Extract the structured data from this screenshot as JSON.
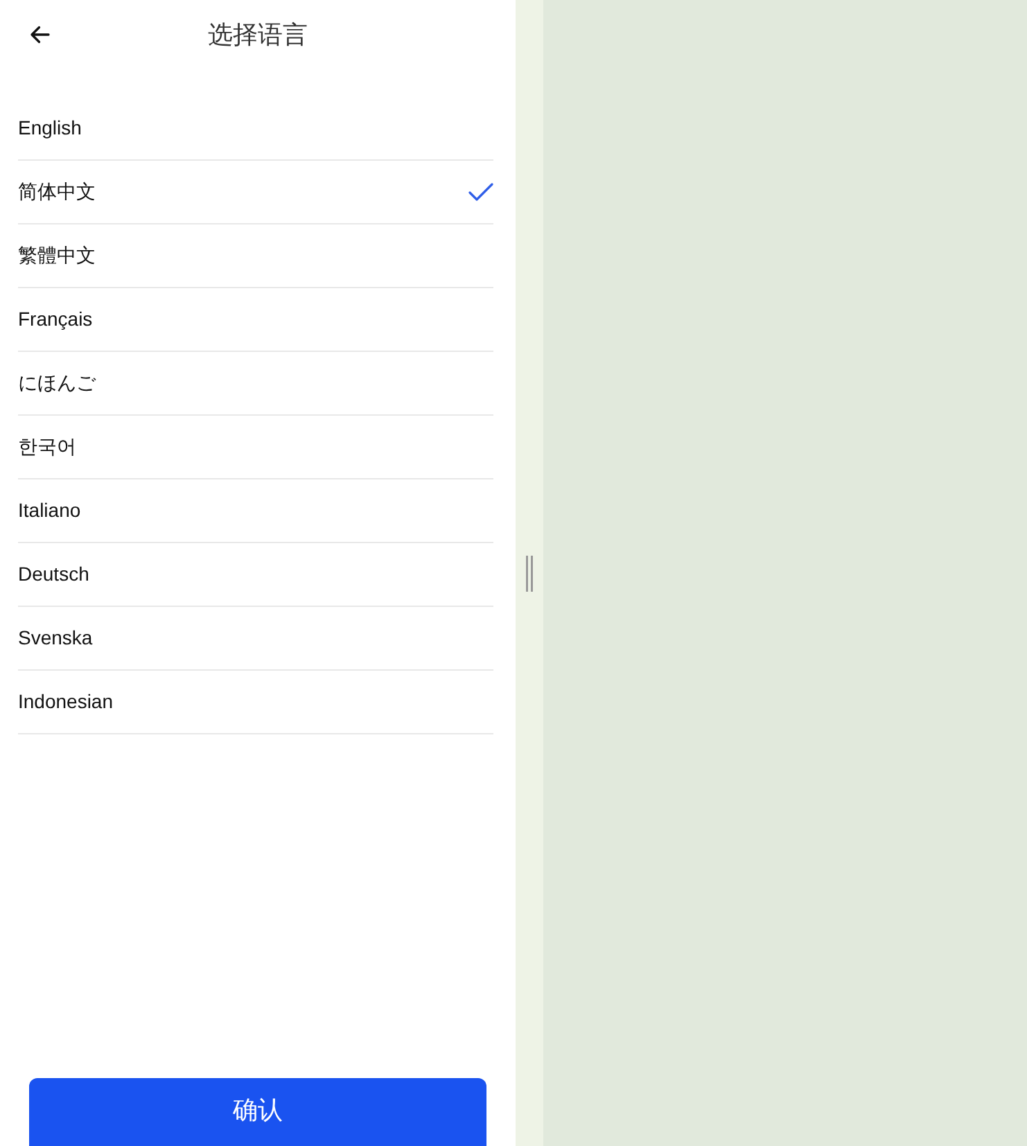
{
  "header": {
    "title": "选择语言"
  },
  "languages": [
    {
      "label": "English",
      "selected": false
    },
    {
      "label": "简体中文",
      "selected": true
    },
    {
      "label": "繁體中文",
      "selected": false
    },
    {
      "label": "Français",
      "selected": false
    },
    {
      "label": "にほんご",
      "selected": false
    },
    {
      "label": "한국어",
      "selected": false
    },
    {
      "label": "Italiano",
      "selected": false
    },
    {
      "label": "Deutsch",
      "selected": false
    },
    {
      "label": "Svenska",
      "selected": false
    },
    {
      "label": "Indonesian",
      "selected": false
    }
  ],
  "confirm_button": "确认"
}
